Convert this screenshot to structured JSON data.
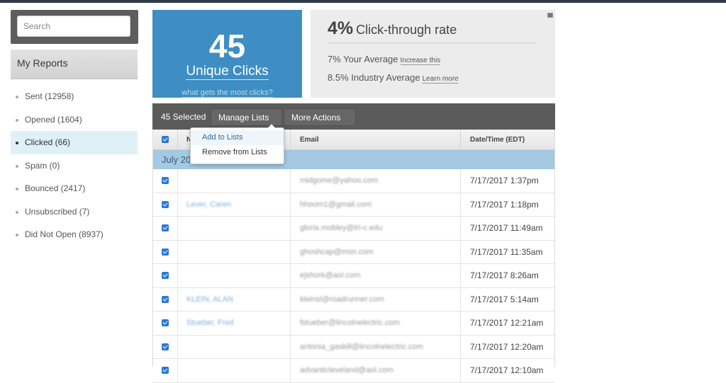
{
  "search": {
    "placeholder": "Search"
  },
  "sidebar": {
    "title": "My Reports",
    "items": [
      {
        "label": "Sent (12958)"
      },
      {
        "label": "Opened (1604)"
      },
      {
        "label": "Clicked (66)"
      },
      {
        "label": "Spam (0)"
      },
      {
        "label": "Bounced (2417)"
      },
      {
        "label": "Unsubscribed (7)"
      },
      {
        "label": "Did Not Open (8937)"
      }
    ],
    "active": "Clicked (66)"
  },
  "stats": {
    "unique_clicks": "45",
    "unique_clicks_label": "Unique Clicks",
    "most_clicks_link": "what gets the most clicks?",
    "ctr_value": "4%",
    "ctr_label": "Click-through rate",
    "your_avg": "7% Your Average",
    "increase_link": "Increase this",
    "industry_avg": "8.5% Industry Average",
    "learn_more": "Learn more"
  },
  "toolbar": {
    "selected": "45 Selected",
    "manage_lists": "Manage Lists",
    "more_actions": "More Actions"
  },
  "dropdown": {
    "items": [
      "Add to Lists",
      "Remove from Lists"
    ]
  },
  "table": {
    "headers": {
      "name": "N",
      "email": "Email",
      "date": "Date/Time (EDT)"
    },
    "group": "July 20",
    "rows": [
      {
        "name": "",
        "email": "midgome@yahoo.com",
        "date": "7/17/2017 1:37pm"
      },
      {
        "name": "Lever, Caren",
        "email": "hhoom1@gmail.com",
        "date": "7/17/2017 1:18pm"
      },
      {
        "name": "",
        "email": "gloria.mobley@tri-c.edu",
        "date": "7/17/2017 11:49am"
      },
      {
        "name": "",
        "email": "ghoshcap@msn.com",
        "date": "7/17/2017 11:35am"
      },
      {
        "name": "",
        "email": "ejshork@aol.com",
        "date": "7/17/2017 8:26am"
      },
      {
        "name": "KLEIN, ALAN",
        "email": "kleinsl@roadrunner.com",
        "date": "7/17/2017 5:14am"
      },
      {
        "name": "Stueber, Fred",
        "email": "fstueber@lincolnelectric.com",
        "date": "7/17/2017 12:21am"
      },
      {
        "name": "",
        "email": "antonia_gaskill@lincolnelectric.com",
        "date": "7/17/2017 12:20am"
      },
      {
        "name": "",
        "email": "advanticleveland@aol.com",
        "date": "7/17/2017 12:10am"
      }
    ]
  },
  "colors": {
    "accent_blue": "#3e8ec3",
    "group_row": "#a5c9e1",
    "checkbox": "#2c79d2",
    "toolbar": "#5b5b5b"
  }
}
